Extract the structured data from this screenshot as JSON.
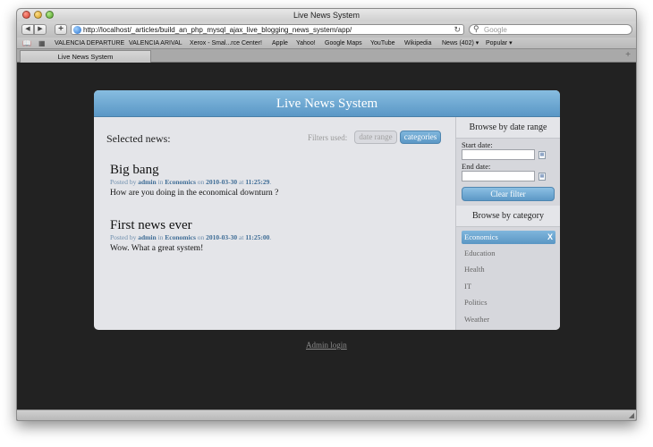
{
  "window": {
    "title": "Live News System"
  },
  "toolbar": {
    "back_glyph": "◀",
    "forward_glyph": "▶",
    "add_glyph": "+",
    "url": "http://localhost/_articles/build_an_php_mysql_ajax_live_blogging_news_system/app/",
    "reload_glyph": "↻",
    "search_placeholder": "Google"
  },
  "bookmarks": [
    "VALENCIA DEPARTURE",
    "VALENCIA ARIVAL",
    "Xerox - Smal...rce Center!",
    "Apple",
    "Yahoo!",
    "Google Maps",
    "YouTube",
    "Wikipedia",
    "News (402) ▾",
    "Popular ▾"
  ],
  "tab": {
    "label": "Live News System"
  },
  "page": {
    "header": "Live News System",
    "selected_label": "Selected news:",
    "filters_label": "Filters used:",
    "filter_chips": [
      "date range",
      "categories"
    ],
    "news": [
      {
        "title": "Big bang",
        "posted_by_prefix": "Posted by",
        "author": "admin",
        "in_word": "in",
        "category": "Economics",
        "on_word": "on",
        "date": "2010-03-30",
        "at_word": "at",
        "time": "11:25:29",
        "body": "How are you doing in the economical downturn ?"
      },
      {
        "title": "First news ever",
        "posted_by_prefix": "Posted by",
        "author": "admin",
        "in_word": "in",
        "category": "Economics",
        "on_word": "on",
        "date": "2010-03-30",
        "at_word": "at",
        "time": "11:25:00",
        "body": "Wow. What a great system!"
      }
    ],
    "sidebar": {
      "date_heading": "Browse by date range",
      "start_label": "Start date:",
      "end_label": "End date:",
      "start_value": "",
      "end_value": "",
      "clear_button": "Clear filter",
      "category_heading": "Browse by category",
      "categories": [
        "Economics",
        "Education",
        "Health",
        "IT",
        "Politics",
        "Weather"
      ],
      "active_category": "Economics",
      "remove_glyph": "X"
    },
    "admin_link": "Admin login"
  },
  "colors": {
    "accent": "#5a97c6",
    "viewport_bg": "#222222",
    "panel_bg": "#e4e5e9",
    "meta_link": "#3f6d96"
  }
}
